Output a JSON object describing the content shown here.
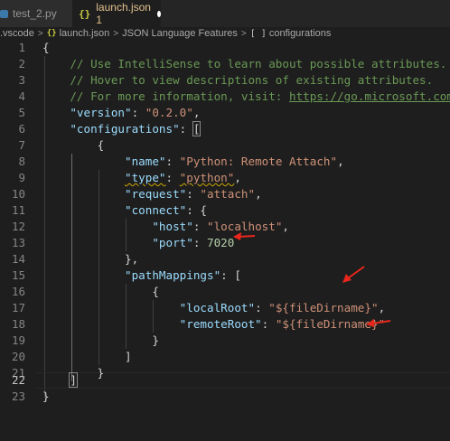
{
  "tabs": [
    {
      "label": "test_2.py",
      "icon": "python-file-icon"
    },
    {
      "label": "launch.json 1",
      "icon": "json-file-icon",
      "modified": true
    }
  ],
  "breadcrumb": {
    "folder": ".vscode",
    "file": "launch.json",
    "section": "JSON Language Features",
    "leaf": "configurations"
  },
  "editor": {
    "active_line": 22,
    "line_numbers": [
      "1",
      "2",
      "3",
      "4",
      "5",
      "6",
      "7",
      "8",
      "9",
      "10",
      "11",
      "12",
      "13",
      "14",
      "15",
      "16",
      "17",
      "18",
      "19",
      "20",
      "21",
      "22",
      "23"
    ],
    "text": {
      "l1_open": "{",
      "l2_comment": "// Use IntelliSense to learn about possible attributes.",
      "l3_comment": "// Hover to view descriptions of existing attributes.",
      "l4_comment": "// For more information, visit: ",
      "l4_link": "https://go.microsoft.com/fw",
      "l5_key": "\"version\"",
      "l5_val": "\"0.2.0\"",
      "l6_key": "\"configurations\"",
      "l6_bracket": "[",
      "l7": "{",
      "l8_key": "\"name\"",
      "l8_val": "\"Python: Remote Attach\"",
      "l9_key": "\"type\"",
      "l9_val": "\"python\"",
      "l10_key": "\"request\"",
      "l10_val": "\"attach\"",
      "l11_key": "\"connect\"",
      "l11_open": "{",
      "l12_key": "\"host\"",
      "l12_val": "\"localhost\"",
      "l13_key": "\"port\"",
      "l13_val": "7020",
      "l14": "},",
      "l15_key": "\"pathMappings\"",
      "l15_open": "[",
      "l16": "{",
      "l17_key": "\"localRoot\"",
      "l17_val": "\"${fileDirname}\"",
      "l18_key": "\"remoteRoot\"",
      "l18_val": "\"${fileDirname}\"",
      "l19": "}",
      "l20": "]",
      "l21": "}",
      "l22": "]",
      "l23": "}"
    }
  },
  "annotation_color": "#e8261c"
}
